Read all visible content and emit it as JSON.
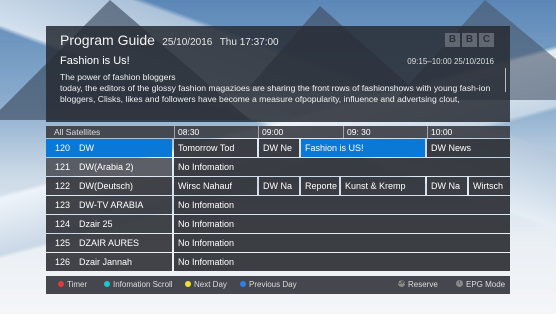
{
  "header": {
    "title": "Program Guide",
    "date": "25/10/2016",
    "time": "Thu  17:37:00",
    "logo": [
      "B",
      "B",
      "C"
    ]
  },
  "program": {
    "title": "Fashion is Us!",
    "when": "09:15–10:00  25/10/2016",
    "synopsis_line1": "The power of fashion bloggers",
    "synopsis_body": "today, the editors of the glossy fashion magazioes are sharing the front rows of fashionshows with young fash-ion bloggers, Clisks, likes and followers have become a measure ofpopularity, influence and advertsing clout,"
  },
  "timeline": {
    "all_satellites": "All Satellites",
    "times": [
      "08:30",
      "09:00",
      "09: 30",
      "10:00"
    ]
  },
  "channels": [
    {
      "num": "120",
      "name": "DW",
      "state": "selected",
      "programs": [
        {
          "title": "Tomorrow Tod"
        },
        {
          "title": "DW Ne"
        },
        {
          "title": "Fashion is US!",
          "focus": true
        },
        {
          "title": "DW News"
        }
      ]
    },
    {
      "num": "121",
      "name": "DW(Arabia 2)",
      "state": "alt",
      "programs": [
        {
          "title": "No Infomation"
        }
      ]
    },
    {
      "num": "122",
      "name": "DW(Deutsch)",
      "programs": [
        {
          "title": "Wirsc Nahauf"
        },
        {
          "title": "DW Na"
        },
        {
          "title": "Reporte"
        },
        {
          "title": "Kunst & Kremp"
        },
        {
          "title": "DW Na"
        },
        {
          "title": "Wirtsch"
        }
      ]
    },
    {
      "num": "123",
      "name": "DW-TV ARABIA",
      "programs": [
        {
          "title": "No Infomation"
        }
      ]
    },
    {
      "num": "124",
      "name": "Dzair 25",
      "programs": [
        {
          "title": "No Infomation"
        }
      ]
    },
    {
      "num": "125",
      "name": "DZAIR AURES",
      "programs": [
        {
          "title": "No Infomation"
        }
      ]
    },
    {
      "num": "126",
      "name": "Dzair Jannah",
      "programs": [
        {
          "title": "No Infomation"
        }
      ]
    }
  ],
  "footer": {
    "timer": "Timer",
    "info_scroll": "Infomation Scroll",
    "next_day": "Next Day",
    "prev_day": "Previous Day",
    "reserve_key": "OK",
    "reserve": "Reserve",
    "epg_key": "i",
    "epg_mode": "EPG Mode"
  },
  "colors": {
    "accent": "#0a78d6",
    "red": "#e03a3a",
    "cyan": "#22c3c9",
    "yellow": "#f0e030",
    "blue": "#2f7fe8"
  }
}
